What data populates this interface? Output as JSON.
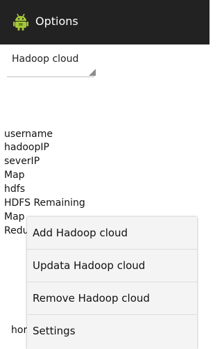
{
  "actionbar": {
    "title": "Options",
    "icon": "android-app-icon",
    "background_color": "#222222"
  },
  "spinner": {
    "selected": "Hadoop cloud"
  },
  "info_list": [
    "username",
    "hadoopIP",
    "severIP",
    "Map",
    "hdfs",
    "HDFS Remaining",
    "Map",
    "Redu",
    "hor"
  ],
  "menu": {
    "items": [
      "Add Hadoop cloud",
      "Updata Hadoop cloud",
      "Remove Hadoop cloud",
      "Settings"
    ]
  }
}
